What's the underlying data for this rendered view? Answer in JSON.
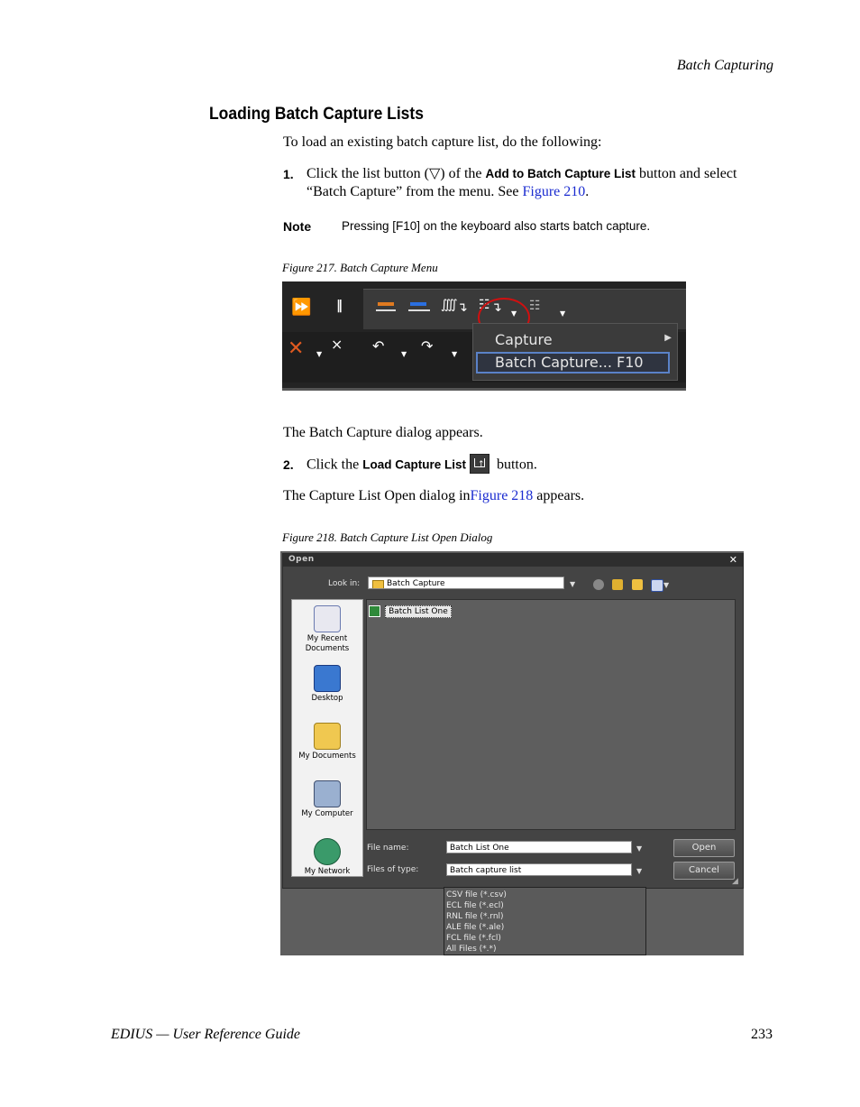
{
  "header": {
    "section": "Batch Capturing"
  },
  "section_title": "Loading Batch Capture Lists",
  "intro": "To load an existing batch capture list, do the following:",
  "step1": {
    "num": "1.",
    "text_a": "Click the list button (▽) of the ",
    "ui_term": "Add to Batch Capture List",
    "text_b": " button and select",
    "text_c": "“Batch Capture” from the menu. See ",
    "link": "Figure 210",
    "text_d": "."
  },
  "note": {
    "label": "Note",
    "text": "Pressing [F10] on the keyboard also starts batch capture."
  },
  "figure217": {
    "caption": "Figure 217.  Batch Capture Menu",
    "menu_items": [
      "Capture",
      "Batch Capture...  F10"
    ],
    "highlight_color": "#d01010",
    "selection_color": "#5a82c8"
  },
  "after_fig217": "The Batch Capture dialog appears.",
  "step2": {
    "num": "2.",
    "text_a": "Click the ",
    "ui_term": "Load Capture List",
    "text_b": " button."
  },
  "capture_list_line": {
    "text_a": "The Capture List Open dialog in",
    "link": "Figure 218",
    "text_b": " appears."
  },
  "figure218": {
    "caption": "Figure 218.  Batch Capture List Open Dialog",
    "dialog": {
      "title": "Open",
      "close": "✕",
      "look_in_label": "Look in:",
      "look_in_value": "Batch Capture",
      "places": [
        "My Recent Documents",
        "Desktop",
        "My Documents",
        "My Computer",
        "My Network"
      ],
      "files": [
        "Batch List One"
      ],
      "file_name_label": "File name:",
      "file_name_value": "Batch List One",
      "file_type_label": "Files of type:",
      "file_type_value": "Batch capture list",
      "open_button": "Open",
      "cancel_button": "Cancel",
      "type_options": [
        "CSV file (*.csv)",
        "ECL file (*.ecl)",
        "RNL file (*.rnl)",
        "ALE file (*.ale)",
        "FCL file (*.fcl)",
        "All Files (*.*)"
      ]
    }
  },
  "footer": {
    "left": "EDIUS  —  User Reference Guide",
    "page": "233"
  }
}
